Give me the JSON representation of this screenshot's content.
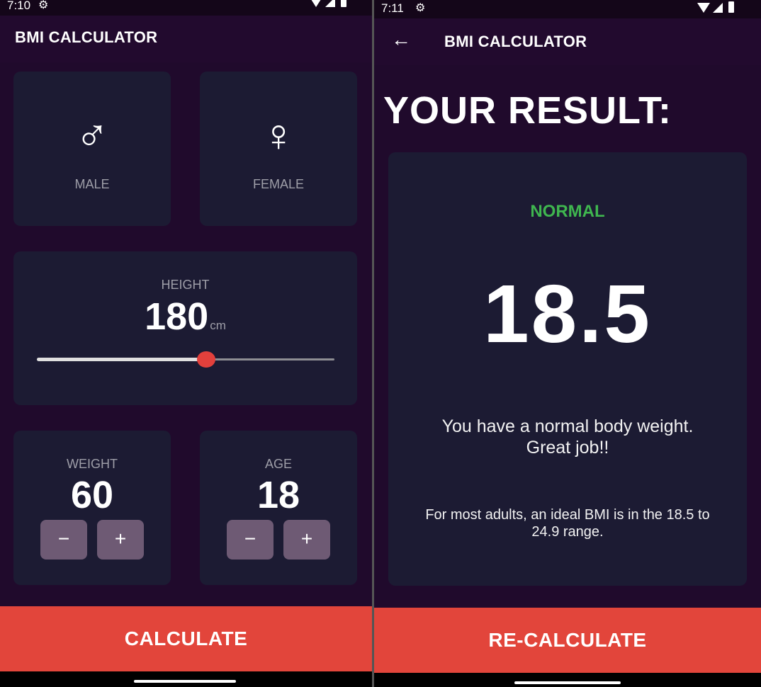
{
  "left_screen": {
    "status_bar": {
      "time": "7:10",
      "gear_icon": "gear-icon"
    },
    "app_bar": {
      "title": "BMI CALCULATOR"
    },
    "gender": {
      "male": {
        "label": "MALE",
        "icon": "♂"
      },
      "female": {
        "label": "FEMALE",
        "icon": "♀"
      }
    },
    "height": {
      "label": "HEIGHT",
      "value": "180",
      "unit": "cm",
      "slider_fraction": 0.57
    },
    "weight": {
      "label": "WEIGHT",
      "value": "60",
      "minus": "−",
      "plus": "+"
    },
    "age": {
      "label": "AGE",
      "value": "18",
      "minus": "−",
      "plus": "+"
    },
    "calculate_button": "CALCULATE"
  },
  "right_screen": {
    "status_bar": {
      "time": "7:11"
    },
    "app_bar": {
      "title": "BMI CALCULATOR",
      "back": "←"
    },
    "heading": "YOUR RESULT:",
    "result": {
      "status": "NORMAL",
      "bmi": "18.5",
      "message_line1": "You have a normal body weight.",
      "message_line2": "Great job!!",
      "note_line1": "For most adults, an ideal BMI is in the 18.5 to",
      "note_line2": "24.9 range."
    },
    "recalculate_button": "RE-CALCULATE"
  },
  "colors": {
    "background": "#200a2c",
    "card": "#1c1b33",
    "accent": "#e2453b",
    "normal_status": "#3fb64f",
    "stepper": "#6e5a74"
  }
}
